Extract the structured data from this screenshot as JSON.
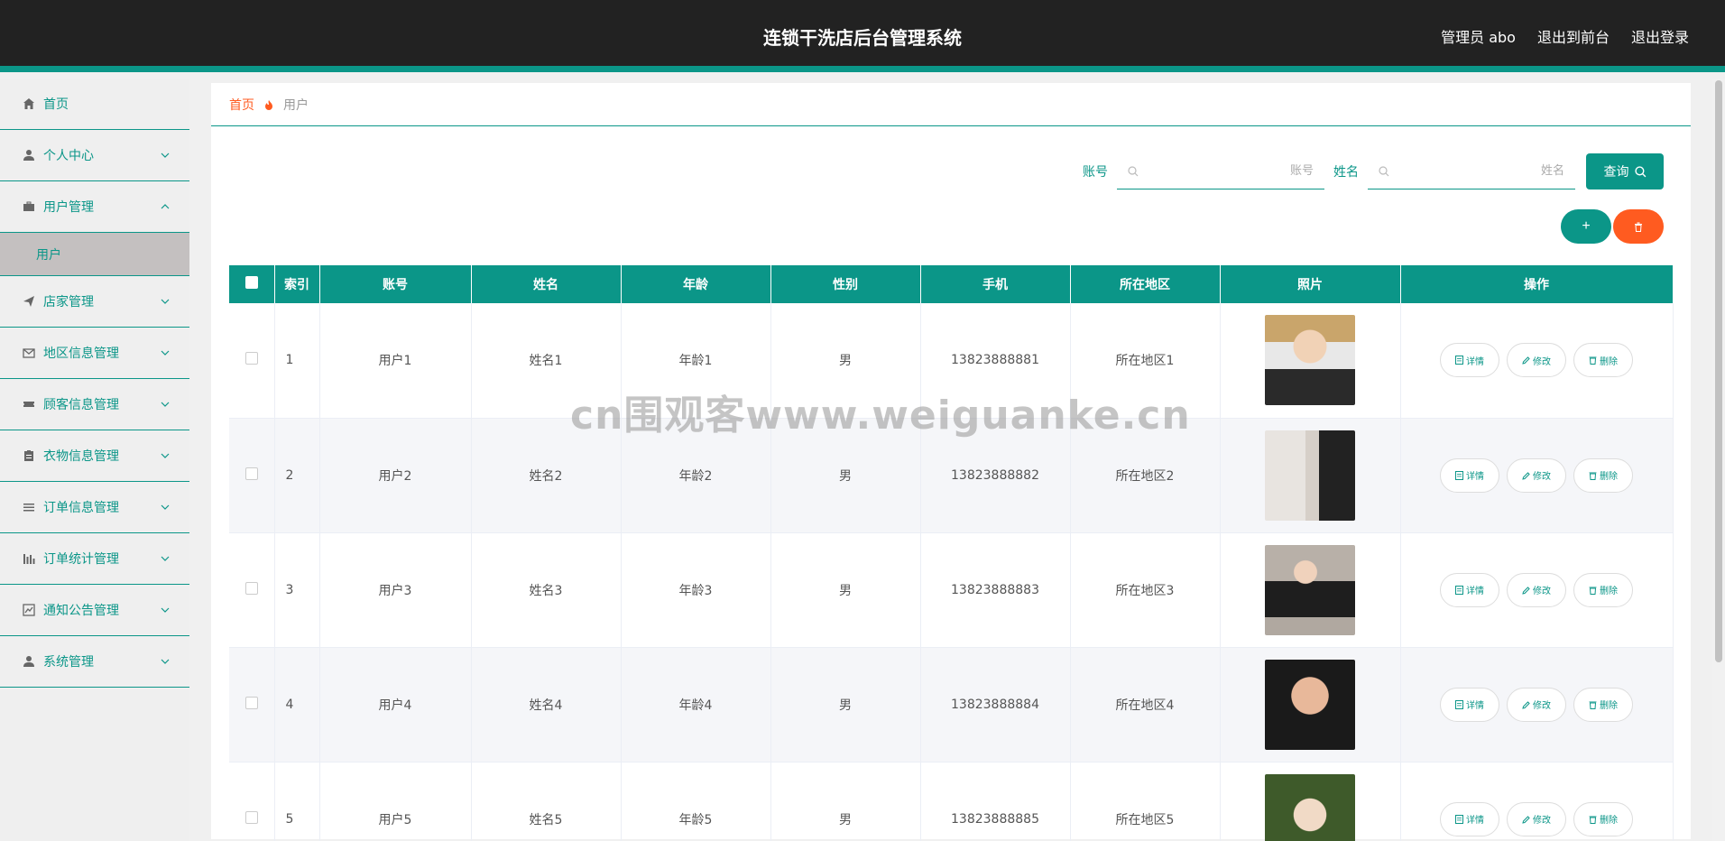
{
  "header": {
    "title": "连锁干洗店后台管理系统",
    "admin": "管理员 abo",
    "to_front": "退出到前台",
    "logout": "退出登录"
  },
  "sidebar": {
    "items": [
      {
        "label": "首页",
        "icon": "home-icon"
      },
      {
        "label": "个人中心",
        "icon": "user-icon"
      },
      {
        "label": "用户管理",
        "icon": "briefcase-icon"
      },
      {
        "label": "店家管理",
        "icon": "send-icon"
      },
      {
        "label": "地区信息管理",
        "icon": "mail-icon"
      },
      {
        "label": "顾客信息管理",
        "icon": "ticket-icon"
      },
      {
        "label": "衣物信息管理",
        "icon": "clipboard-icon"
      },
      {
        "label": "订单信息管理",
        "icon": "list-icon"
      },
      {
        "label": "订单统计管理",
        "icon": "bar-chart-icon"
      },
      {
        "label": "通知公告管理",
        "icon": "line-chart-icon"
      },
      {
        "label": "系统管理",
        "icon": "user-icon"
      }
    ],
    "sub_user": "用户"
  },
  "breadcrumb": {
    "home": "首页",
    "current": "用户"
  },
  "search": {
    "account_label": "账号",
    "account_placeholder": "账号",
    "name_label": "姓名",
    "name_placeholder": "姓名",
    "button": "查询"
  },
  "actions": {
    "add": "+"
  },
  "table": {
    "headers": [
      "索引",
      "账号",
      "姓名",
      "年龄",
      "性别",
      "手机",
      "所在地区",
      "照片",
      "操作"
    ],
    "op_labels": {
      "detail": "详情",
      "edit": "修改",
      "delete": "删除"
    },
    "rows": [
      {
        "index": "1",
        "account": "用户1",
        "name": "姓名1",
        "age": "年龄1",
        "gender": "男",
        "phone": "13823888881",
        "region": "所在地区1"
      },
      {
        "index": "2",
        "account": "用户2",
        "name": "姓名2",
        "age": "年龄2",
        "gender": "男",
        "phone": "13823888882",
        "region": "所在地区2"
      },
      {
        "index": "3",
        "account": "用户3",
        "name": "姓名3",
        "age": "年龄3",
        "gender": "男",
        "phone": "13823888883",
        "region": "所在地区3"
      },
      {
        "index": "4",
        "account": "用户4",
        "name": "姓名4",
        "age": "年龄4",
        "gender": "男",
        "phone": "13823888884",
        "region": "所在地区4"
      },
      {
        "index": "5",
        "account": "用户5",
        "name": "姓名5",
        "age": "年龄5",
        "gender": "男",
        "phone": "13823888885",
        "region": "所在地区5"
      }
    ]
  },
  "watermark": "cn围观客www.weiguanke.cn",
  "colors": {
    "primary": "#0b9688",
    "danger": "#ff5b20",
    "header_bg": "#222222"
  }
}
